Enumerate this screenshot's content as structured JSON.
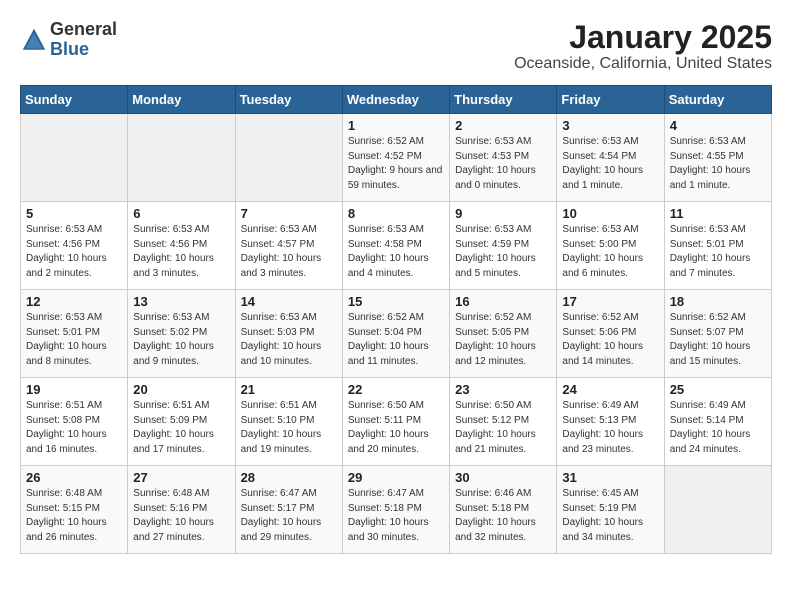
{
  "logo": {
    "general": "General",
    "blue": "Blue"
  },
  "title": "January 2025",
  "subtitle": "Oceanside, California, United States",
  "headers": [
    "Sunday",
    "Monday",
    "Tuesday",
    "Wednesday",
    "Thursday",
    "Friday",
    "Saturday"
  ],
  "weeks": [
    [
      {
        "day": "",
        "detail": ""
      },
      {
        "day": "",
        "detail": ""
      },
      {
        "day": "",
        "detail": ""
      },
      {
        "day": "1",
        "detail": "Sunrise: 6:52 AM\nSunset: 4:52 PM\nDaylight: 9 hours and 59 minutes."
      },
      {
        "day": "2",
        "detail": "Sunrise: 6:53 AM\nSunset: 4:53 PM\nDaylight: 10 hours and 0 minutes."
      },
      {
        "day": "3",
        "detail": "Sunrise: 6:53 AM\nSunset: 4:54 PM\nDaylight: 10 hours and 1 minute."
      },
      {
        "day": "4",
        "detail": "Sunrise: 6:53 AM\nSunset: 4:55 PM\nDaylight: 10 hours and 1 minute."
      }
    ],
    [
      {
        "day": "5",
        "detail": "Sunrise: 6:53 AM\nSunset: 4:56 PM\nDaylight: 10 hours and 2 minutes."
      },
      {
        "day": "6",
        "detail": "Sunrise: 6:53 AM\nSunset: 4:56 PM\nDaylight: 10 hours and 3 minutes."
      },
      {
        "day": "7",
        "detail": "Sunrise: 6:53 AM\nSunset: 4:57 PM\nDaylight: 10 hours and 3 minutes."
      },
      {
        "day": "8",
        "detail": "Sunrise: 6:53 AM\nSunset: 4:58 PM\nDaylight: 10 hours and 4 minutes."
      },
      {
        "day": "9",
        "detail": "Sunrise: 6:53 AM\nSunset: 4:59 PM\nDaylight: 10 hours and 5 minutes."
      },
      {
        "day": "10",
        "detail": "Sunrise: 6:53 AM\nSunset: 5:00 PM\nDaylight: 10 hours and 6 minutes."
      },
      {
        "day": "11",
        "detail": "Sunrise: 6:53 AM\nSunset: 5:01 PM\nDaylight: 10 hours and 7 minutes."
      }
    ],
    [
      {
        "day": "12",
        "detail": "Sunrise: 6:53 AM\nSunset: 5:01 PM\nDaylight: 10 hours and 8 minutes."
      },
      {
        "day": "13",
        "detail": "Sunrise: 6:53 AM\nSunset: 5:02 PM\nDaylight: 10 hours and 9 minutes."
      },
      {
        "day": "14",
        "detail": "Sunrise: 6:53 AM\nSunset: 5:03 PM\nDaylight: 10 hours and 10 minutes."
      },
      {
        "day": "15",
        "detail": "Sunrise: 6:52 AM\nSunset: 5:04 PM\nDaylight: 10 hours and 11 minutes."
      },
      {
        "day": "16",
        "detail": "Sunrise: 6:52 AM\nSunset: 5:05 PM\nDaylight: 10 hours and 12 minutes."
      },
      {
        "day": "17",
        "detail": "Sunrise: 6:52 AM\nSunset: 5:06 PM\nDaylight: 10 hours and 14 minutes."
      },
      {
        "day": "18",
        "detail": "Sunrise: 6:52 AM\nSunset: 5:07 PM\nDaylight: 10 hours and 15 minutes."
      }
    ],
    [
      {
        "day": "19",
        "detail": "Sunrise: 6:51 AM\nSunset: 5:08 PM\nDaylight: 10 hours and 16 minutes."
      },
      {
        "day": "20",
        "detail": "Sunrise: 6:51 AM\nSunset: 5:09 PM\nDaylight: 10 hours and 17 minutes."
      },
      {
        "day": "21",
        "detail": "Sunrise: 6:51 AM\nSunset: 5:10 PM\nDaylight: 10 hours and 19 minutes."
      },
      {
        "day": "22",
        "detail": "Sunrise: 6:50 AM\nSunset: 5:11 PM\nDaylight: 10 hours and 20 minutes."
      },
      {
        "day": "23",
        "detail": "Sunrise: 6:50 AM\nSunset: 5:12 PM\nDaylight: 10 hours and 21 minutes."
      },
      {
        "day": "24",
        "detail": "Sunrise: 6:49 AM\nSunset: 5:13 PM\nDaylight: 10 hours and 23 minutes."
      },
      {
        "day": "25",
        "detail": "Sunrise: 6:49 AM\nSunset: 5:14 PM\nDaylight: 10 hours and 24 minutes."
      }
    ],
    [
      {
        "day": "26",
        "detail": "Sunrise: 6:48 AM\nSunset: 5:15 PM\nDaylight: 10 hours and 26 minutes."
      },
      {
        "day": "27",
        "detail": "Sunrise: 6:48 AM\nSunset: 5:16 PM\nDaylight: 10 hours and 27 minutes."
      },
      {
        "day": "28",
        "detail": "Sunrise: 6:47 AM\nSunset: 5:17 PM\nDaylight: 10 hours and 29 minutes."
      },
      {
        "day": "29",
        "detail": "Sunrise: 6:47 AM\nSunset: 5:18 PM\nDaylight: 10 hours and 30 minutes."
      },
      {
        "day": "30",
        "detail": "Sunrise: 6:46 AM\nSunset: 5:18 PM\nDaylight: 10 hours and 32 minutes."
      },
      {
        "day": "31",
        "detail": "Sunrise: 6:45 AM\nSunset: 5:19 PM\nDaylight: 10 hours and 34 minutes."
      },
      {
        "day": "",
        "detail": ""
      }
    ]
  ]
}
